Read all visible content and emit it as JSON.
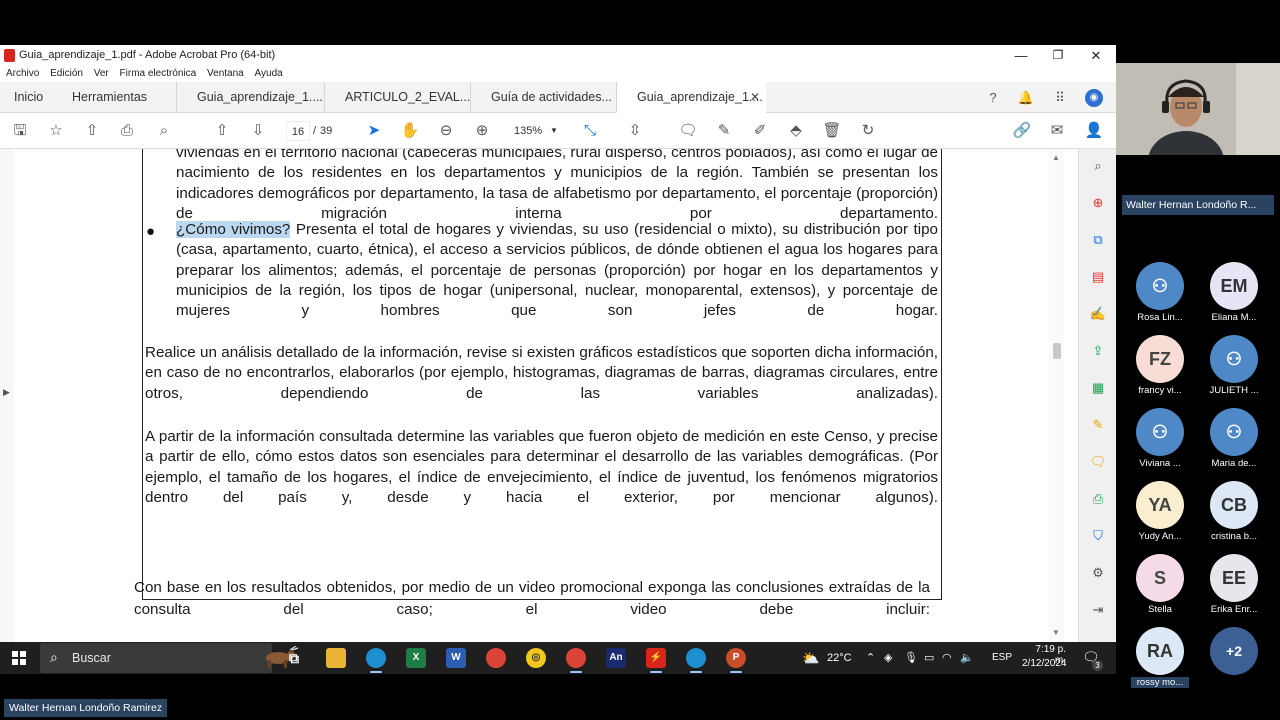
{
  "window": {
    "title": "Guia_aprendizaje_1.pdf - Adobe Acrobat Pro (64-bit)",
    "minimize": "—",
    "restore": "❐",
    "close": "✕"
  },
  "menu": [
    "Archivo",
    "Edición",
    "Ver",
    "Firma electrónica",
    "Ventana",
    "Ayuda"
  ],
  "nav": {
    "home": "Inicio",
    "tools": "Herramientas"
  },
  "tabs": [
    "Guia_aprendizaje_1....",
    "ARTICULO_2_EVAL...",
    "Guía de actividades...",
    "Guia_aprendizaje_1...."
  ],
  "toolbar": {
    "page_current": "16",
    "page_sep": "/",
    "page_total": "39",
    "zoom": "135%"
  },
  "document": {
    "p1": "viviendas en el territorio nacional (cabeceras municipales, rural disperso, centros poblados), así como el lugar de nacimiento de los residentes en los departamentos y municipios de la región. También se presentan los indicadores demográficos por departamento, la tasa de alfabetismo por departamento, el porcentaje (proporción) de migración interna por departamento.",
    "bullet_symbol": "●",
    "bullet_highlight": "¿Cómo vivimos?",
    "bullet_text": " Presenta el total de hogares y viviendas, su uso (residencial o mixto), su distribución por tipo (casa, apartamento, cuarto, étnica), el acceso a servicios públicos, de dónde obtienen el agua los hogares para preparar los alimentos; además, el porcentaje de personas (proporción) por hogar en los departamentos y municipios de la región, los tipos de hogar (unipersonal, nuclear, monoparental, extensos), y porcentaje de mujeres y hombres que son jefes de hogar.",
    "p2": "Realice un análisis detallado de la información, revise si existen gráficos estadísticos que soporten dicha información, en caso de no encontrarlos, elaborarlos (por ejemplo, histogramas, diagramas de barras, diagramas circulares, entre otros, dependiendo de las variables analizadas).",
    "p3": "A partir de la información consultada determine las variables que fueron objeto de medición en este Censo, y precise a partir de ello, cómo estos datos son esenciales para determinar el desarrollo de las variables demográficas.  (Por ejemplo, el tamaño de los hogares, el índice de envejecimiento, el índice de juventud, los fenómenos migratorios dentro del país y, desde y hacia el exterior, por mencionar algunos).",
    "p4": "Con base en los resultados obtenidos, por medio de un video promocional exponga las conclusiones extraídas de la consulta del caso; el video debe incluir:"
  },
  "taskbar": {
    "search": "Buscar",
    "temperature": "22°C",
    "language": "ESP",
    "time": "7:19 p. m.",
    "date": "2/12/2024",
    "notifications": "3"
  },
  "meeting": {
    "presenter": "Walter Hernan Londoño R...",
    "bottom_label": "Walter Hernan Londoño Ramirez",
    "participants": [
      {
        "initials": "",
        "name": "Rosa Lin...",
        "color": "#4f88c6"
      },
      {
        "initials": "EM",
        "name": "Eliana M...",
        "color": "#e9e4f5"
      },
      {
        "initials": "FZ",
        "name": "francy vi...",
        "color": "#f8dcd6"
      },
      {
        "initials": "",
        "name": "JULIETH ...",
        "color": "#4f88c6"
      },
      {
        "initials": "",
        "name": "Viviana ...",
        "color": "#4f88c6"
      },
      {
        "initials": "",
        "name": "Maria de...",
        "color": "#4f88c6"
      },
      {
        "initials": "YA",
        "name": "Yudy An...",
        "color": "#faeed0"
      },
      {
        "initials": "CB",
        "name": "cristina b...",
        "color": "#dce8f6"
      },
      {
        "initials": "S",
        "name": "Stella",
        "color": "#f4dbe7"
      },
      {
        "initials": "EE",
        "name": "Erika Enr...",
        "color": "#e6e6ec"
      },
      {
        "initials": "RA",
        "name": "rossy mo...",
        "color": "#dce8f6"
      },
      {
        "initials": "+2",
        "name": "",
        "color": "#3c5f94"
      }
    ]
  }
}
